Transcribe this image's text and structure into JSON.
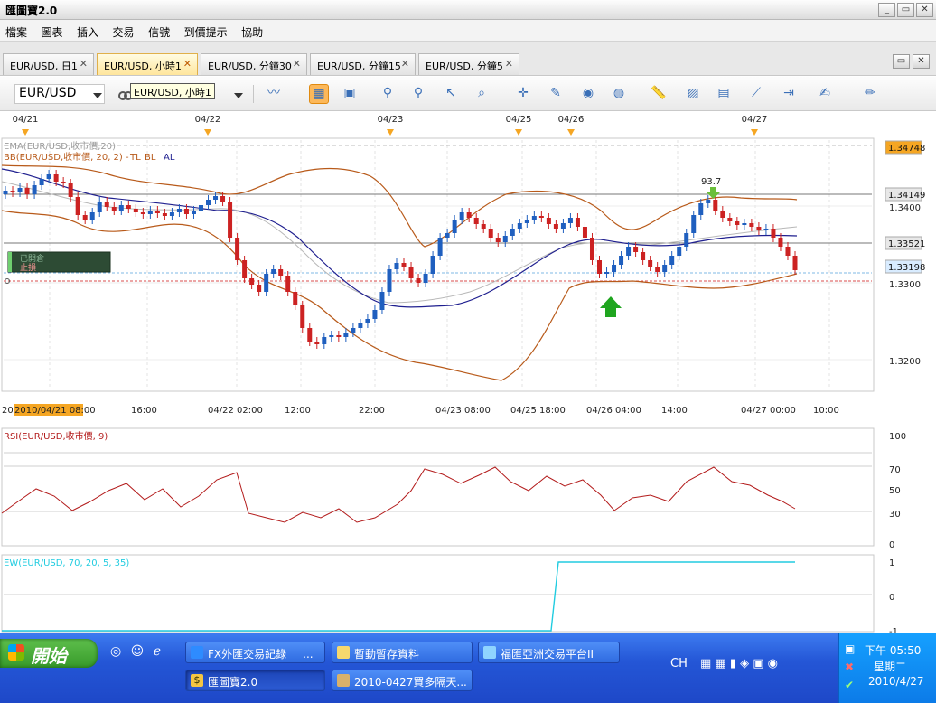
{
  "window": {
    "title": "匯圖寶2.0"
  },
  "menu": [
    "檔案",
    "圖表",
    "插入",
    "交易",
    "信號",
    "到價提示",
    "協助"
  ],
  "tabs": [
    {
      "label": "EUR/USD, 日1",
      "active": false
    },
    {
      "label": "EUR/USD, 小時1",
      "active": true
    },
    {
      "label": "EUR/USD, 分鐘30",
      "active": false
    },
    {
      "label": "EUR/USD, 分鐘15",
      "active": false
    },
    {
      "label": "EUR/USD, 分鐘5",
      "active": false
    }
  ],
  "toolbar": {
    "symbol": "EUR/USD",
    "tooltip": "EUR/USD, 小時1",
    "icons": [
      "line-chart-icon",
      "bar-chart-icon",
      "candle-chart-icon",
      "zoom-in-icon",
      "zoom-out-icon",
      "cursor-icon",
      "magnifier-icon",
      "crosshair-icon",
      "edit-icon",
      "eye-icon",
      "globe-icon",
      "ruler-icon",
      "image-icon",
      "template-icon",
      "draw-line-icon",
      "indicator-icon",
      "pen-icon",
      "brush-icon"
    ]
  },
  "date_markers": [
    "04/21",
    "04/22",
    "04/23",
    "04/25",
    "04/26",
    "04/27"
  ],
  "main_chart": {
    "ema_label": "EMA(EUR/USD,收市價,20)",
    "bb_label": "BB(EUR/USD,收市價, 20, 2) - ",
    "bb_tags": [
      "TL",
      "BL",
      "AL"
    ],
    "y_ticks": [
      "1.3400",
      "1.3300",
      "1.3200"
    ],
    "price_tags": [
      {
        "text": "1.34748",
        "color": "#f5a623"
      },
      {
        "text": "1.34149",
        "color": "#e8e8e8"
      },
      {
        "text": "1.33521",
        "color": "#e8e8e8"
      },
      {
        "text": "1.33198",
        "color": "#d9ecff"
      }
    ],
    "peak_label": "93.7",
    "order_box": {
      "line1": "已開倉",
      "line2": "止損"
    },
    "time_axis": [
      "2010",
      "2010/04/21 08:00",
      "16:00",
      "04/22 02:00",
      "12:00",
      "22:00",
      "04/23 08:00",
      "04/25 18:00",
      "04/26 04:00",
      "14:00",
      "04/27 00:00",
      "10:00"
    ]
  },
  "rsi_panel": {
    "label": "RSI(EUR/USD,收市價, 9)",
    "y_ticks": [
      "100",
      "70",
      "50",
      "30",
      "0"
    ]
  },
  "ew_panel": {
    "label": "EW(EUR/USD, 70, 20, 5, 35)",
    "y_ticks": [
      "1",
      "0",
      "-1"
    ]
  },
  "taskbar": {
    "start": "開始",
    "tasks": [
      {
        "label": "FX外匯交易紀錄",
        "active": false
      },
      {
        "label": "暫動暫存資料",
        "active": false
      },
      {
        "label": "福匯亞洲交易平台II",
        "active": false
      },
      {
        "label": "匯圖寶2.0",
        "active": true
      },
      {
        "label": "2010-0427買多隔天...",
        "active": false
      }
    ],
    "lang": "CH",
    "clock": {
      "time": "下午 05:50",
      "day": "星期二",
      "date": "2010/4/27"
    }
  },
  "colors": {
    "up": "#1f5fbf",
    "down": "#cc2222",
    "bb": "#b85a1a",
    "ema": "#1f1f8f",
    "rsi": "#b31b1b",
    "ew": "#22cce0",
    "accent": "#f5a623"
  }
}
